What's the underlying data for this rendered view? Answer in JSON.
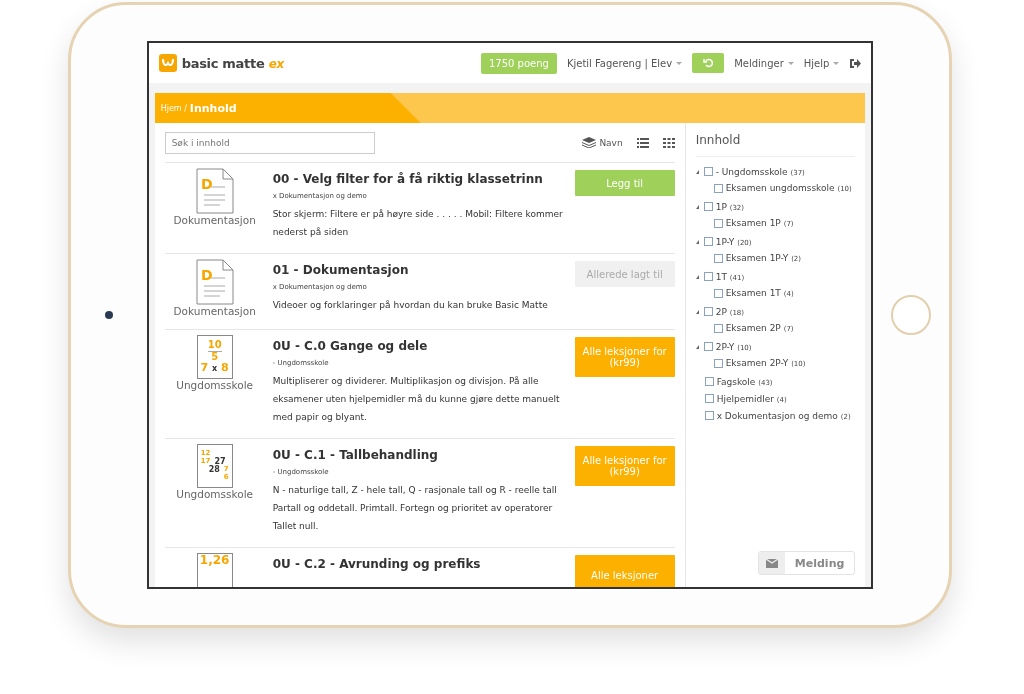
{
  "header": {
    "logo": {
      "name": "basic matte",
      "suffix": "ex"
    },
    "points": "1750 poeng",
    "user": "Kjetil Fagereng | Elev",
    "menus": [
      "Meldinger",
      "Hjelp"
    ]
  },
  "breadcrumb": {
    "home": "Hjem /",
    "current": "Innhold"
  },
  "search": {
    "placeholder": "Søk i innhold"
  },
  "sort": {
    "label": "Navn"
  },
  "items": [
    {
      "thumb": {
        "kind": "doc",
        "glyphs": [
          "D"
        ],
        "caption": "Dokumentasjon"
      },
      "title": "00 - Velg filter for å få riktig klassetrinn",
      "tag": "x Dokumentasjon og demo",
      "description": "Stor skjerm: Filtere er på høyre side . . . . . Mobil: Filtere kommer nederst på siden",
      "button": {
        "kind": "add",
        "label": "Legg til"
      }
    },
    {
      "thumb": {
        "kind": "doc",
        "glyphs": [
          "D"
        ],
        "caption": "Dokumentasjon"
      },
      "title": "01 - Dokumentasjon",
      "tag": "x Dokumentasjon og demo",
      "description": "Videoer og forklaringer på hvordan du kan bruke Basic Matte",
      "button": {
        "kind": "added",
        "label": "Allerede lagt til"
      }
    },
    {
      "thumb": {
        "kind": "fraction",
        "glyphs": [
          "10",
          "5",
          "7",
          "x",
          "8"
        ],
        "caption": "Ungdomsskole"
      },
      "title": "0U - C.0 Gange og dele",
      "tag": "- Ungdomsskole",
      "description": "Multipliserer og dividerer. Multiplikasjon og divisjon. På alle eksamener uten hjelpemidler må du kunne gjøre dette manuelt med papir og blyant.",
      "button": {
        "kind": "buy",
        "label": "Alle leksjoner for (kr99)"
      }
    },
    {
      "thumb": {
        "kind": "numbers",
        "glyphs": [
          "12",
          "17",
          "27",
          "28",
          "7",
          "6"
        ],
        "caption": "Ungdomsskole"
      },
      "title": "0U - C.1 - Tallbehandling",
      "tag": "- Ungdomsskole",
      "description": "N - naturlige tall, Z - hele tall, Q - rasjonale tall og R - reelle tall Partall og oddetall. Primtall. Fortegn og prioritet av operatorer Tallet null.",
      "button": {
        "kind": "buy",
        "label": "Alle leksjoner for (kr99)"
      }
    },
    {
      "thumb": {
        "kind": "decimal",
        "glyphs": [
          "1,26"
        ]
      },
      "title": "0U - C.2 - Avrunding og prefiks",
      "button": {
        "kind": "buy",
        "label": "Alle leksjoner"
      }
    }
  ],
  "sidebar": {
    "title": "Innhold",
    "tree": [
      {
        "label": "- Ungdomsskole",
        "count": "(37)",
        "checked": false,
        "expanded": true,
        "children": [
          {
            "label": "Eksamen ungdomsskole",
            "count": "(10)",
            "checked": false
          }
        ]
      },
      {
        "label": "1P",
        "count": "(32)",
        "checked": false,
        "expanded": true,
        "children": [
          {
            "label": "Eksamen 1P",
            "count": "(7)",
            "checked": false
          }
        ]
      },
      {
        "label": "1P-Y",
        "count": "(20)",
        "checked": false,
        "expanded": true,
        "children": [
          {
            "label": "Eksamen 1P-Y",
            "count": "(2)",
            "checked": false
          }
        ]
      },
      {
        "label": "1T",
        "count": "(41)",
        "checked": false,
        "expanded": true,
        "children": [
          {
            "label": "Eksamen 1T",
            "count": "(4)",
            "checked": false
          }
        ]
      },
      {
        "label": "2P",
        "count": "(18)",
        "checked": false,
        "expanded": true,
        "children": [
          {
            "label": "Eksamen 2P",
            "count": "(7)",
            "checked": false
          }
        ]
      },
      {
        "label": "2P-Y",
        "count": "(10)",
        "checked": false,
        "expanded": true,
        "children": [
          {
            "label": "Eksamen 2P-Y",
            "count": "(10)",
            "checked": false
          }
        ]
      },
      {
        "label": "Fagskole",
        "count": "(43)",
        "checked": false
      },
      {
        "label": "Hjelpemidler",
        "count": "(4)",
        "checked": false
      },
      {
        "label": "x Dokumentasjon og demo",
        "count": "(2)",
        "checked": false
      }
    ]
  },
  "message_button": {
    "label": "Melding"
  }
}
